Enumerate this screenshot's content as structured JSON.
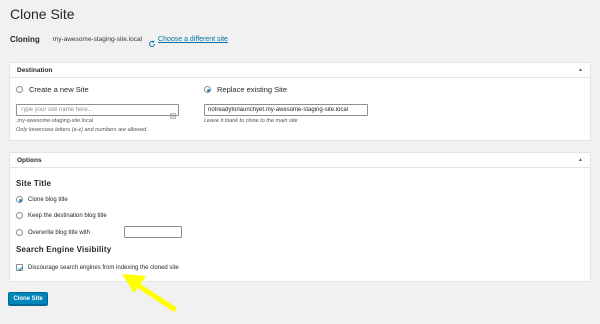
{
  "page": {
    "title": "Clone Site"
  },
  "cloning": {
    "label": "Cloning",
    "site": "my-awesome-staging-site.local",
    "choose_link": "Choose a different site"
  },
  "destination": {
    "title": "Destination",
    "toggle_icon": "triangle-up-icon",
    "create_option": {
      "label": "Create a new Site",
      "checked": false
    },
    "replace_option": {
      "label": "Replace existing Site",
      "checked": true
    },
    "new_site_input": {
      "value": "",
      "placeholder": "Type your site name here..."
    },
    "new_site_suffix": ".my-awesome-staging-site.local",
    "new_site_help": "Only lowercase letters (a-z) and numbers are allowed.",
    "replace_input": {
      "value": "notreadyforlaunchyet.my-awesome-staging-site.local",
      "placeholder": ""
    },
    "replace_help": "Leave it blank to clone to the main site"
  },
  "options": {
    "title": "Options",
    "toggle_icon": "triangle-up-icon",
    "site_title_heading": "Site Title",
    "site_title_options": [
      {
        "label": "Clone blog title",
        "checked": true
      },
      {
        "label": "Keep the destination blog title",
        "checked": false
      },
      {
        "label": "Overwrite blog title with",
        "checked": false
      }
    ],
    "overwrite_input": {
      "value": "",
      "placeholder": ""
    },
    "search_heading": "Search Engine Visibility",
    "discourage": {
      "label": "Discourage search engines from indexing the cloned site",
      "checked": true
    }
  },
  "actions": {
    "submit_label": "Clone Site"
  },
  "colors": {
    "primary": "#0085ba",
    "link": "#0073aa",
    "annotation_arrow": "#ffff00"
  }
}
